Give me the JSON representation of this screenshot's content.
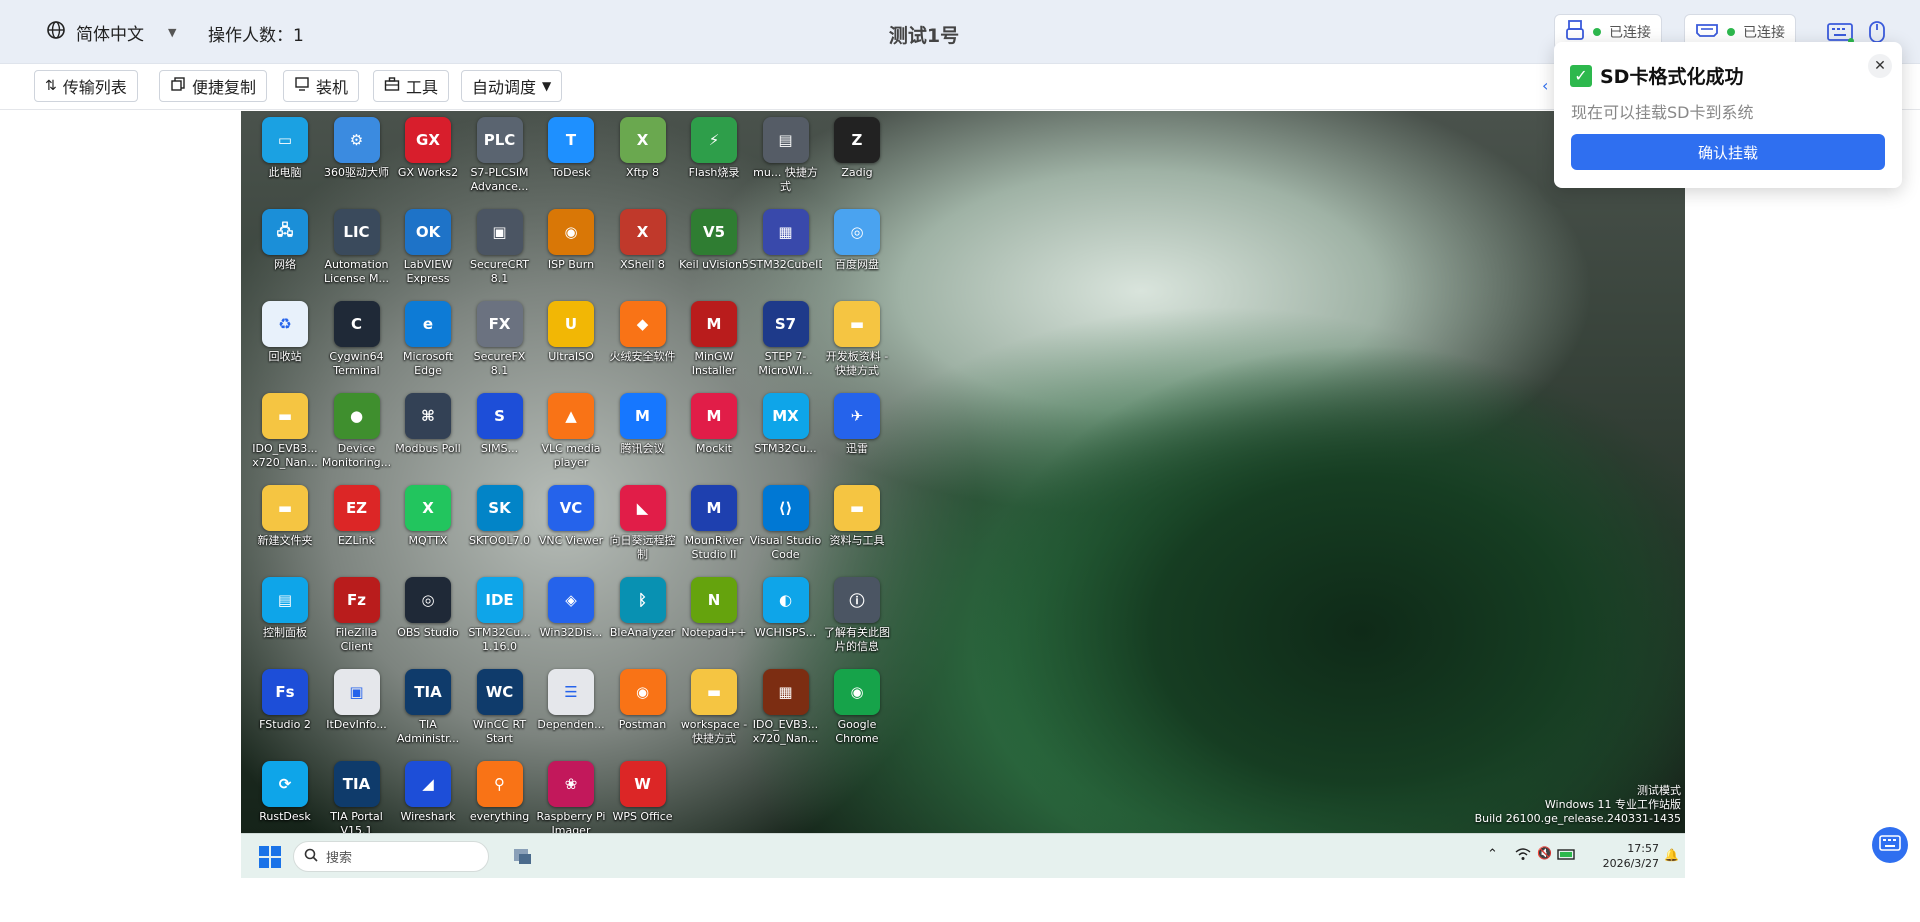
{
  "header": {
    "language": "简体中文",
    "operators": "操作人数：1",
    "title": "测试1号",
    "conn1_status": "已连接",
    "conn2_status": "已连接"
  },
  "toolbar": {
    "transfer": "传输列表",
    "quick_copy": "便捷复制",
    "install": "装机",
    "tools": "工具",
    "auto_schedule": "自动调度"
  },
  "notification": {
    "title": "SD卡格式化成功",
    "message": "现在可以挂载SD卡到系统",
    "button": "确认挂载"
  },
  "desktop": {
    "icons": [
      {
        "label": "此电脑",
        "color": "#1ba1e2",
        "glyph": "▭"
      },
      {
        "label": "360驱动大师",
        "color": "#3b8be0",
        "glyph": "⚙"
      },
      {
        "label": "GX Works2",
        "color": "#d81e2c",
        "glyph": "GX"
      },
      {
        "label": "S7-PLCSIM Advance...",
        "color": "#5a6470",
        "glyph": "PLC"
      },
      {
        "label": "ToDesk",
        "color": "#1e90ff",
        "glyph": "T"
      },
      {
        "label": "Xftp 8",
        "color": "#6aa84f",
        "glyph": "X"
      },
      {
        "label": "Flash烧录",
        "color": "#2e9e4a",
        "glyph": "⚡"
      },
      {
        "label": "mu... 快捷方式",
        "color": "#555c66",
        "glyph": "▤"
      },
      {
        "label": "Zadig",
        "color": "#222222",
        "glyph": "Z"
      },
      {
        "label": "网络",
        "color": "#1b8fd8",
        "glyph": "🖧"
      },
      {
        "label": "Automation License M...",
        "color": "#3a4a5c",
        "glyph": "LIC"
      },
      {
        "label": "LabVIEW Express",
        "color": "#1e73c8",
        "glyph": "OK"
      },
      {
        "label": "SecureCRT 8.1",
        "color": "#4b5563",
        "glyph": "▣"
      },
      {
        "label": "ISP Burn",
        "color": "#d97706",
        "glyph": "◉"
      },
      {
        "label": "XShell 8",
        "color": "#c0392b",
        "glyph": "X"
      },
      {
        "label": "Keil uVision5",
        "color": "#2f7d32",
        "glyph": "V5"
      },
      {
        "label": "STM32CubeIDE",
        "color": "#3949ab",
        "glyph": "▦"
      },
      {
        "label": "百度网盘",
        "color": "#4aa3f0",
        "glyph": "◎"
      },
      {
        "label": "回收站",
        "color": "#e8f1fb",
        "glyph": "♻"
      },
      {
        "label": "Cygwin64 Terminal",
        "color": "#1f2937",
        "glyph": "C"
      },
      {
        "label": "Microsoft Edge",
        "color": "#0d7bd6",
        "glyph": "e"
      },
      {
        "label": "SecureFX 8.1",
        "color": "#6b7280",
        "glyph": "FX"
      },
      {
        "label": "UltraISO",
        "color": "#f2b705",
        "glyph": "U"
      },
      {
        "label": "火绒安全软件",
        "color": "#f97316",
        "glyph": "◆"
      },
      {
        "label": "MinGW Installer",
        "color": "#b91c1c",
        "glyph": "M"
      },
      {
        "label": "STEP 7-MicroWI...",
        "color": "#1e3a8a",
        "glyph": "S7"
      },
      {
        "label": "开发板资料 - 快捷方式",
        "color": "#f5c542",
        "glyph": "▬"
      },
      {
        "label": "IDO_EVB3... x720_Nan...",
        "color": "#f5c542",
        "glyph": "▬"
      },
      {
        "label": "Device Monitoring...",
        "color": "#3f8f2e",
        "glyph": "●"
      },
      {
        "label": "Modbus Poll",
        "color": "#334155",
        "glyph": "⌘"
      },
      {
        "label": "SIMS...",
        "color": "#1d4ed8",
        "glyph": "S"
      },
      {
        "label": "VLC media player",
        "color": "#f97316",
        "glyph": "▲"
      },
      {
        "label": "腾讯会议",
        "color": "#1677ff",
        "glyph": "M"
      },
      {
        "label": "Mockit",
        "color": "#e11d48",
        "glyph": "M"
      },
      {
        "label": "STM32Cu...",
        "color": "#0ea5e9",
        "glyph": "MX"
      },
      {
        "label": "迅雷",
        "color": "#2563eb",
        "glyph": "✈"
      },
      {
        "label": "新建文件夹",
        "color": "#f5c542",
        "glyph": "▬"
      },
      {
        "label": "EZLink",
        "color": "#dc2626",
        "glyph": "EZ"
      },
      {
        "label": "MQTTX",
        "color": "#22c55e",
        "glyph": "X"
      },
      {
        "label": "SKTOOL7.0",
        "color": "#0284c7",
        "glyph": "SK"
      },
      {
        "label": "VNC Viewer",
        "color": "#2563eb",
        "glyph": "VC"
      },
      {
        "label": "向日葵远程控制",
        "color": "#e11d48",
        "glyph": "◣"
      },
      {
        "label": "MounRiver Studio II",
        "color": "#1e40af",
        "glyph": "M"
      },
      {
        "label": "Visual Studio Code",
        "color": "#0078d4",
        "glyph": "⟨⟩"
      },
      {
        "label": "资料与工具",
        "color": "#f5c542",
        "glyph": "▬"
      },
      {
        "label": "控制面板",
        "color": "#0ea5e9",
        "glyph": "▤"
      },
      {
        "label": "FileZilla Client",
        "color": "#b91c1c",
        "glyph": "Fz"
      },
      {
        "label": "OBS Studio",
        "color": "#1f2937",
        "glyph": "◎"
      },
      {
        "label": "STM32Cu... 1.16.0",
        "color": "#0ea5e9",
        "glyph": "IDE"
      },
      {
        "label": "Win32Dis...",
        "color": "#2563eb",
        "glyph": "◈"
      },
      {
        "label": "BleAnalyzer",
        "color": "#0891b2",
        "glyph": "ᛒ"
      },
      {
        "label": "Notepad++",
        "color": "#65a30d",
        "glyph": "N"
      },
      {
        "label": "WCHISPS...",
        "color": "#0ea5e9",
        "glyph": "◐"
      },
      {
        "label": "了解有关此图片的信息",
        "color": "#4b5563",
        "glyph": "ⓘ"
      },
      {
        "label": "FStudio 2",
        "color": "#1d4ed8",
        "glyph": "Fs"
      },
      {
        "label": "ItDevInfo...",
        "color": "#e5e7eb",
        "glyph": "▣"
      },
      {
        "label": "TIA Administr...",
        "color": "#0f3b6b",
        "glyph": "TIA"
      },
      {
        "label": "WinCC RT Start",
        "color": "#0f3b6b",
        "glyph": "WC"
      },
      {
        "label": "Dependen...",
        "color": "#e5e7eb",
        "glyph": "☰"
      },
      {
        "label": "Postman",
        "color": "#f97316",
        "glyph": "◉"
      },
      {
        "label": "workspace - 快捷方式",
        "color": "#f5c542",
        "glyph": "▬"
      },
      {
        "label": "IDO_EVB3... x720_Nan...",
        "color": "#7c2d12",
        "glyph": "▦"
      },
      {
        "label": "Google Chrome",
        "color": "#16a34a",
        "glyph": "◉"
      },
      {
        "label": "RustDesk",
        "color": "#0ea5e9",
        "glyph": "⟳"
      },
      {
        "label": "TIA Portal V15.1",
        "color": "#0f3b6b",
        "glyph": "TIA"
      },
      {
        "label": "Wireshark",
        "color": "#1d4ed8",
        "glyph": "◢"
      },
      {
        "label": "everything",
        "color": "#f97316",
        "glyph": "⚲"
      },
      {
        "label": "Raspberry Pi Imager",
        "color": "#c2185b",
        "glyph": "❀"
      },
      {
        "label": "WPS Office",
        "color": "#dc2626",
        "glyph": "W"
      }
    ],
    "watermark_line1": "测试模式",
    "watermark_line2": "Windows 11 专业工作站版",
    "watermark_line3": "Build 26100.ge_release.240331-1435",
    "search_placeholder": "搜索",
    "time": "17:57",
    "date": "2026/3/27"
  }
}
